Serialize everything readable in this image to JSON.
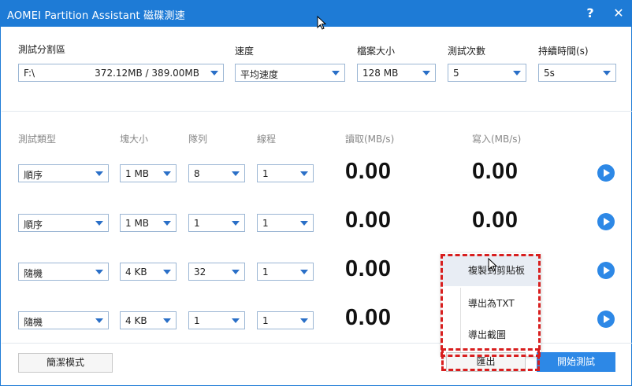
{
  "window": {
    "title": "AOMEI Partition Assistant 磁碟測速",
    "help": "?",
    "close": "✕"
  },
  "top": {
    "partition": {
      "label": "測試分割區",
      "drive": "F:\\",
      "size": "372.12MB / 389.00MB"
    },
    "speed": {
      "label": "速度",
      "value": "平均速度"
    },
    "filesize": {
      "label": "檔案大小",
      "value": "128 MB"
    },
    "count": {
      "label": "測試次數",
      "value": "5"
    },
    "duration": {
      "label": "持續時間(s)",
      "value": "5s"
    }
  },
  "headers": {
    "type": "測試類型",
    "block": "塊大小",
    "queue": "隊列",
    "thread": "線程",
    "read": "讀取(MB/s)",
    "write": "寫入(MB/s)"
  },
  "rows": [
    {
      "type": "順序",
      "block": "1 MB",
      "queue": "8",
      "thread": "1",
      "read": "0.00",
      "write": "0.00"
    },
    {
      "type": "順序",
      "block": "1 MB",
      "queue": "1",
      "thread": "1",
      "read": "0.00",
      "write": "0.00"
    },
    {
      "type": "隨機",
      "block": "4 KB",
      "queue": "32",
      "thread": "1",
      "read": "0.00"
    },
    {
      "type": "隨機",
      "block": "4 KB",
      "queue": "1",
      "thread": "1",
      "read": "0.00"
    }
  ],
  "menu": {
    "items": [
      "複製到剪貼板",
      "導出為TXT",
      "導出截圖"
    ]
  },
  "footer": {
    "simple": "簡潔模式",
    "export": "匯出",
    "start": "開始測試"
  },
  "colors": {
    "accent": "#1e7bd6",
    "highlight": "#d81e1e"
  }
}
